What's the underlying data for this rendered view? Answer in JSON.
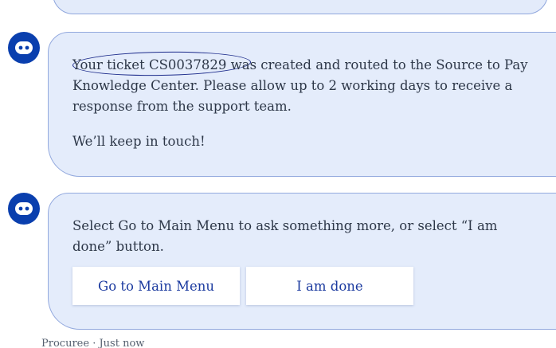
{
  "messages": [
    {
      "sender_icon": "chatbot-icon",
      "paragraph1_before": "Your ticket ",
      "ticket_number": "CS0037829",
      "paragraph1_after": " was created and routed to the Source to Pay Knowledge Center. Please allow up to 2 working days to receive a response from the support team.",
      "paragraph2": "We’ll keep in touch!"
    },
    {
      "sender_icon": "chatbot-icon",
      "paragraph1": "Select Go to Main Menu to ask something more, or select “I am done” button.",
      "buttons": {
        "main_menu": "Go to Main Menu",
        "done": "I am done"
      }
    }
  ],
  "footer": {
    "sender": "Procuree",
    "separator": "·",
    "time": "Just now"
  },
  "colors": {
    "avatar": "#0a3fae",
    "bubble_bg": "#e4ecfb",
    "bubble_border": "#93a9de",
    "button_text": "#1b3a9f",
    "annotation_ring": "#1b2a8a"
  }
}
